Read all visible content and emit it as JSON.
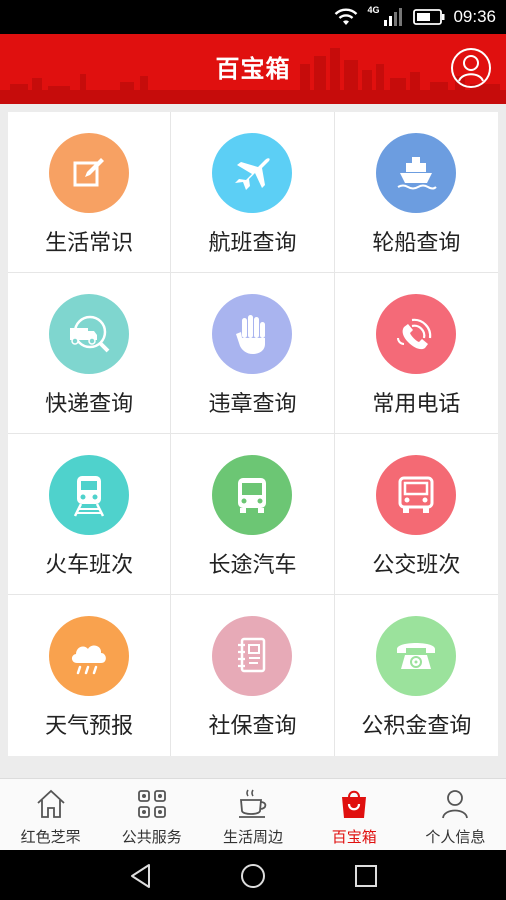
{
  "status_bar": {
    "network": "4G",
    "time": "09:36"
  },
  "header": {
    "title": "百宝箱"
  },
  "grid": {
    "items": [
      {
        "label": "生活常识",
        "icon": "edit-icon",
        "color": "#f7a163"
      },
      {
        "label": "航班查询",
        "icon": "airplane-icon",
        "color": "#5ccff5"
      },
      {
        "label": "轮船查询",
        "icon": "ship-icon",
        "color": "#6c9de0"
      },
      {
        "label": "快递查询",
        "icon": "delivery-truck-icon",
        "color": "#7fd6cf"
      },
      {
        "label": "违章查询",
        "icon": "hand-icon",
        "color": "#a9b4ef"
      },
      {
        "label": "常用电话",
        "icon": "phone-icon",
        "color": "#f46a78"
      },
      {
        "label": "火车班次",
        "icon": "train-icon",
        "color": "#4fd2cc"
      },
      {
        "label": "长途汽车",
        "icon": "coach-bus-icon",
        "color": "#6cc674"
      },
      {
        "label": "公交班次",
        "icon": "city-bus-icon",
        "color": "#f46a74"
      },
      {
        "label": "天气预报",
        "icon": "rain-cloud-icon",
        "color": "#f9a24e"
      },
      {
        "label": "社保查询",
        "icon": "notebook-icon",
        "color": "#e7aab7"
      },
      {
        "label": "公积金查询",
        "icon": "telephone-icon",
        "color": "#9be29c"
      }
    ]
  },
  "bottom_nav": {
    "items": [
      {
        "label": "红色芝罘",
        "icon": "home-icon"
      },
      {
        "label": "公共服务",
        "icon": "apps-grid-icon"
      },
      {
        "label": "生活周边",
        "icon": "coffee-cup-icon"
      },
      {
        "label": "百宝箱",
        "icon": "shopping-bag-icon",
        "active": true
      },
      {
        "label": "个人信息",
        "icon": "person-icon"
      }
    ]
  },
  "colors": {
    "brand_red": "#e0100f",
    "nav_active": "#e0100f",
    "nav_inactive": "#333333"
  }
}
